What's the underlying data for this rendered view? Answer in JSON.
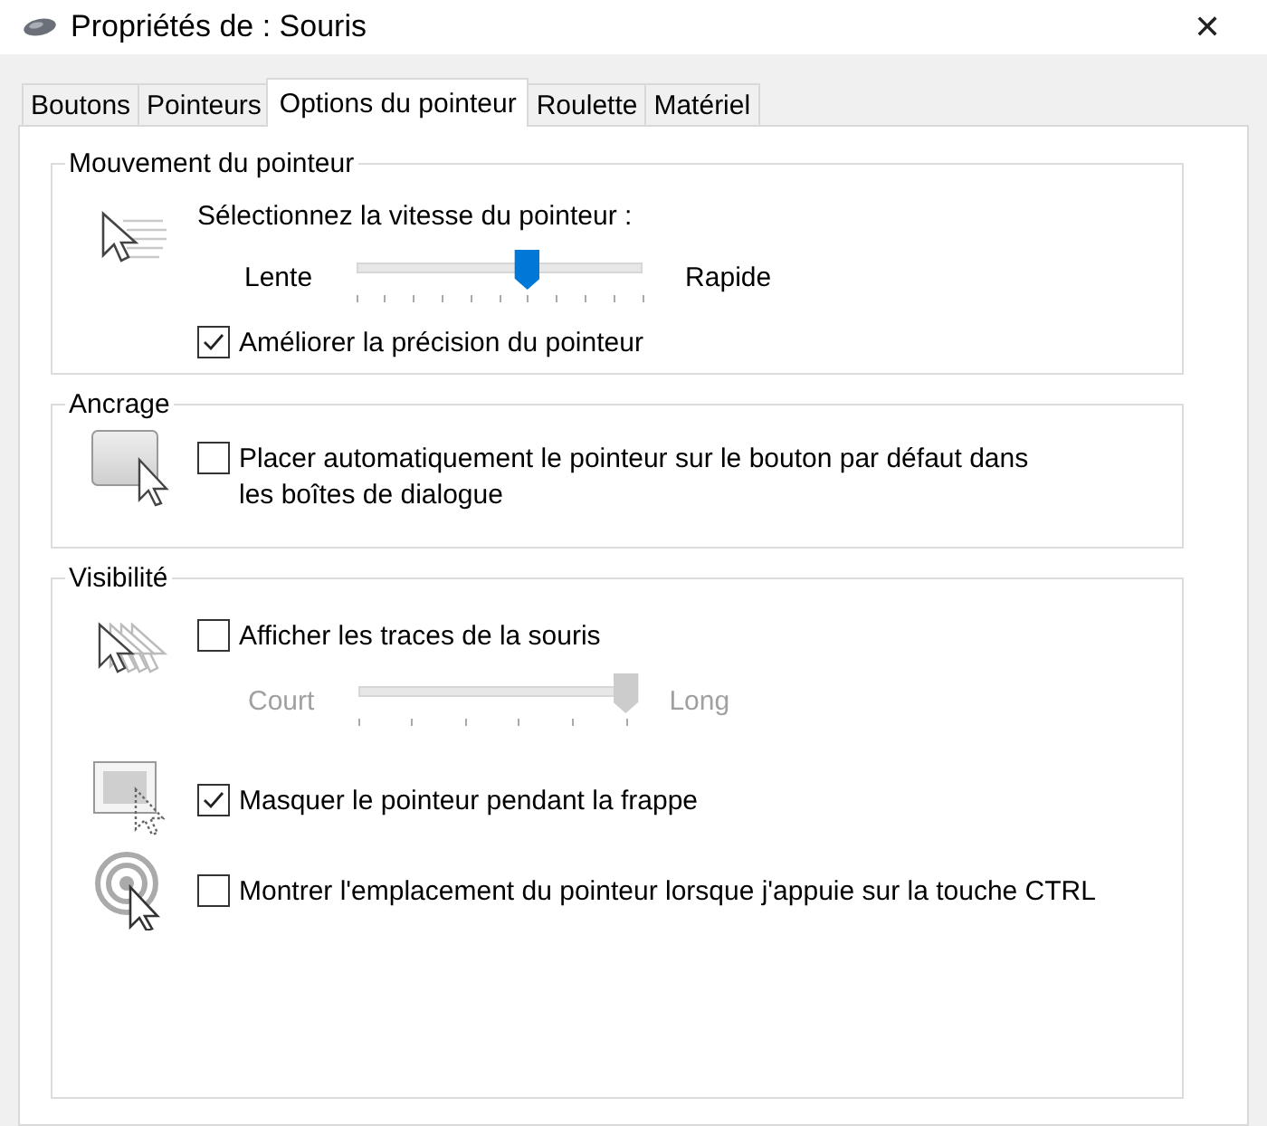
{
  "window": {
    "title": "Propriétés de : Souris",
    "close": "✕"
  },
  "tabs": [
    {
      "label": "Boutons",
      "selected": false
    },
    {
      "label": "Pointeurs",
      "selected": false
    },
    {
      "label": "Options du pointeur",
      "selected": true
    },
    {
      "label": "Roulette",
      "selected": false
    },
    {
      "label": "Matériel",
      "selected": false
    }
  ],
  "motion": {
    "title": "Mouvement du pointeur",
    "prompt": "Sélectionnez la vitesse du pointeur :",
    "slider": {
      "min_label": "Lente",
      "max_label": "Rapide",
      "level": 0.6,
      "disabled": false
    },
    "enhance": {
      "label": "Améliorer la précision du pointeur",
      "checked": true
    }
  },
  "snap": {
    "title": "Ancrage",
    "option": {
      "label": "Placer automatiquement le pointeur sur le bouton par défaut dans les boîtes de dialogue",
      "checked": false
    }
  },
  "visibility": {
    "title": "Visibilité",
    "trails": {
      "label": "Afficher les traces de la souris",
      "checked": false
    },
    "trail_slider": {
      "min_label": "Court",
      "max_label": "Long",
      "level": 1,
      "disabled": true
    },
    "hide": {
      "label": "Masquer le pointeur pendant la frappe",
      "checked": true
    },
    "locate": {
      "label": "Montrer l'emplacement du pointeur lorsque j'appuie sur la touche CTRL",
      "checked": false
    }
  }
}
